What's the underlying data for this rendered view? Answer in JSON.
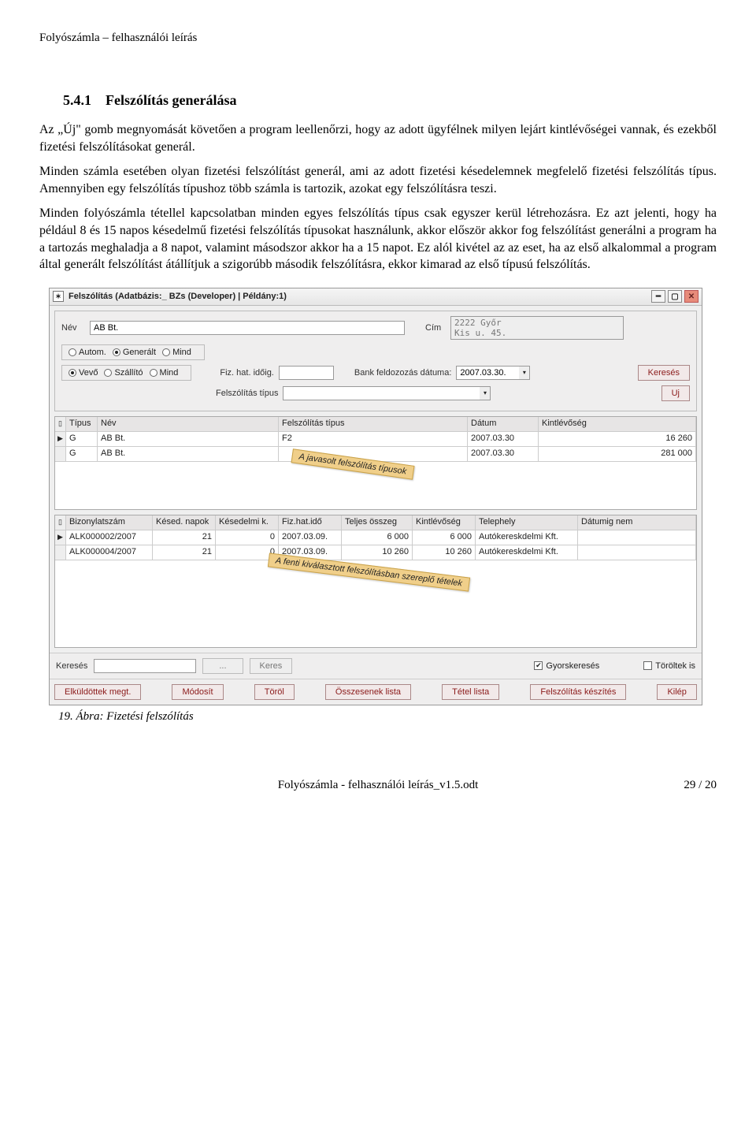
{
  "doc": {
    "header": "Folyószámla – felhasználói leírás",
    "section_number": "5.4.1",
    "section_title": "Felszólítás generálása",
    "p1": "Az „Új\" gomb megnyomását követően a program leellenőrzi, hogy az adott ügyfélnek milyen lejárt kintlévőségei vannak, és ezekből fizetési felszólításokat generál.",
    "p2": "Minden számla esetében olyan fizetési felszólítást generál, ami az adott fizetési késedelemnek megfelelő fizetési felszólítás típus. Amennyiben egy felszólítás típushoz több számla is tartozik, azokat egy felszólításra teszi.",
    "p3": "Minden folyószámla tétellel kapcsolatban minden egyes felszólítás típus csak egyszer kerül létrehozásra. Ez azt jelenti, hogy ha például 8 és 15 napos késedelmű fizetési felszólítás típusokat használunk, akkor először akkor fog felszólítást generálni a program ha a tartozás meghaladja a 8 napot, valamint másodszor akkor ha a 15 napot. Ez alól kivétel az az eset, ha az első alkalommal a program által generált felszólítást átállítjuk a szigorúbb második felszólításra, ekkor kimarad az első típusú felszólítás.",
    "figure_caption": "19. Ábra: Fizetési felszólítás",
    "footer_left": "Folyószámla - felhasználói leírás_v1.5.odt",
    "footer_right": "29 / 20"
  },
  "app": {
    "title": "Felszólítás  (Adatbázis:_ BZs (Developer) | Példány:1)",
    "labels": {
      "nev": "Név",
      "cim": "Cím",
      "autom": "Autom.",
      "generalt": "Generált",
      "mind": "Mind",
      "vevo": "Vevő",
      "szallito": "Szállító",
      "fiz_hat_idoig": "Fiz. hat. időig.",
      "bank_datum": "Bank feldozozás dátuma:",
      "felsz_tipus": "Felszólítás típus",
      "kereses_btn": "Keresés",
      "uj_btn": "Uj",
      "kereses_lbl": "Keresés",
      "gyorskereses": "Gyorskeresés",
      "toroltek": "Töröltek is",
      "dots": "..."
    },
    "fields": {
      "nev_value": "AB Bt.",
      "cim_value": "2222 Győr\nKis u. 45.",
      "bank_datum_value": "2007.03.30."
    },
    "callout1": "A javasolt felszólítás típusok",
    "callout2": "A fenti kiválasztott felszólításban\nszereplő tételek",
    "grid1": {
      "headers": [
        "Típus",
        "Név",
        "Felszólítás típus",
        "Dátum",
        "Kintlévőség"
      ],
      "rows": [
        {
          "mark": "▶",
          "tip": "G",
          "nev": "AB Bt.",
          "ft": "F2",
          "datum": "2007.03.30",
          "kint": "16 260"
        },
        {
          "mark": "",
          "tip": "G",
          "nev": "AB Bt.",
          "ft": "",
          "datum": "2007.03.30",
          "kint": "281 000"
        }
      ]
    },
    "grid2": {
      "headers": [
        "Bizonylatszám",
        "Késed. napok",
        "Késedelmi k.",
        "Fiz.hat.idő",
        "Teljes összeg",
        "Kintlévőség",
        "Telephely",
        "Dátumig nem"
      ],
      "rows": [
        {
          "mark": "▶",
          "biz": "ALK000002/2007",
          "kn": "21",
          "kk": "0",
          "fh": "2007.03.09.",
          "to": "6 000",
          "ki": "6 000",
          "th": "Autókereskdelmi Kft.",
          "dn": ""
        },
        {
          "mark": "",
          "biz": "ALK000004/2007",
          "kn": "21",
          "kk": "0",
          "fh": "2007.03.09.",
          "to": "10 260",
          "ki": "10 260",
          "th": "Autókereskdelmi Kft.",
          "dn": ""
        }
      ]
    },
    "actions": {
      "elkuldottek": "Elküldöttek megt.",
      "modosit": "Módosít",
      "torol": "Töröl",
      "osszesenek": "Összesenek lista",
      "tetel": "Tétel lista",
      "keszites": "Felszólítás készítés",
      "kilep": "Kilép",
      "keres": "Keres"
    }
  }
}
